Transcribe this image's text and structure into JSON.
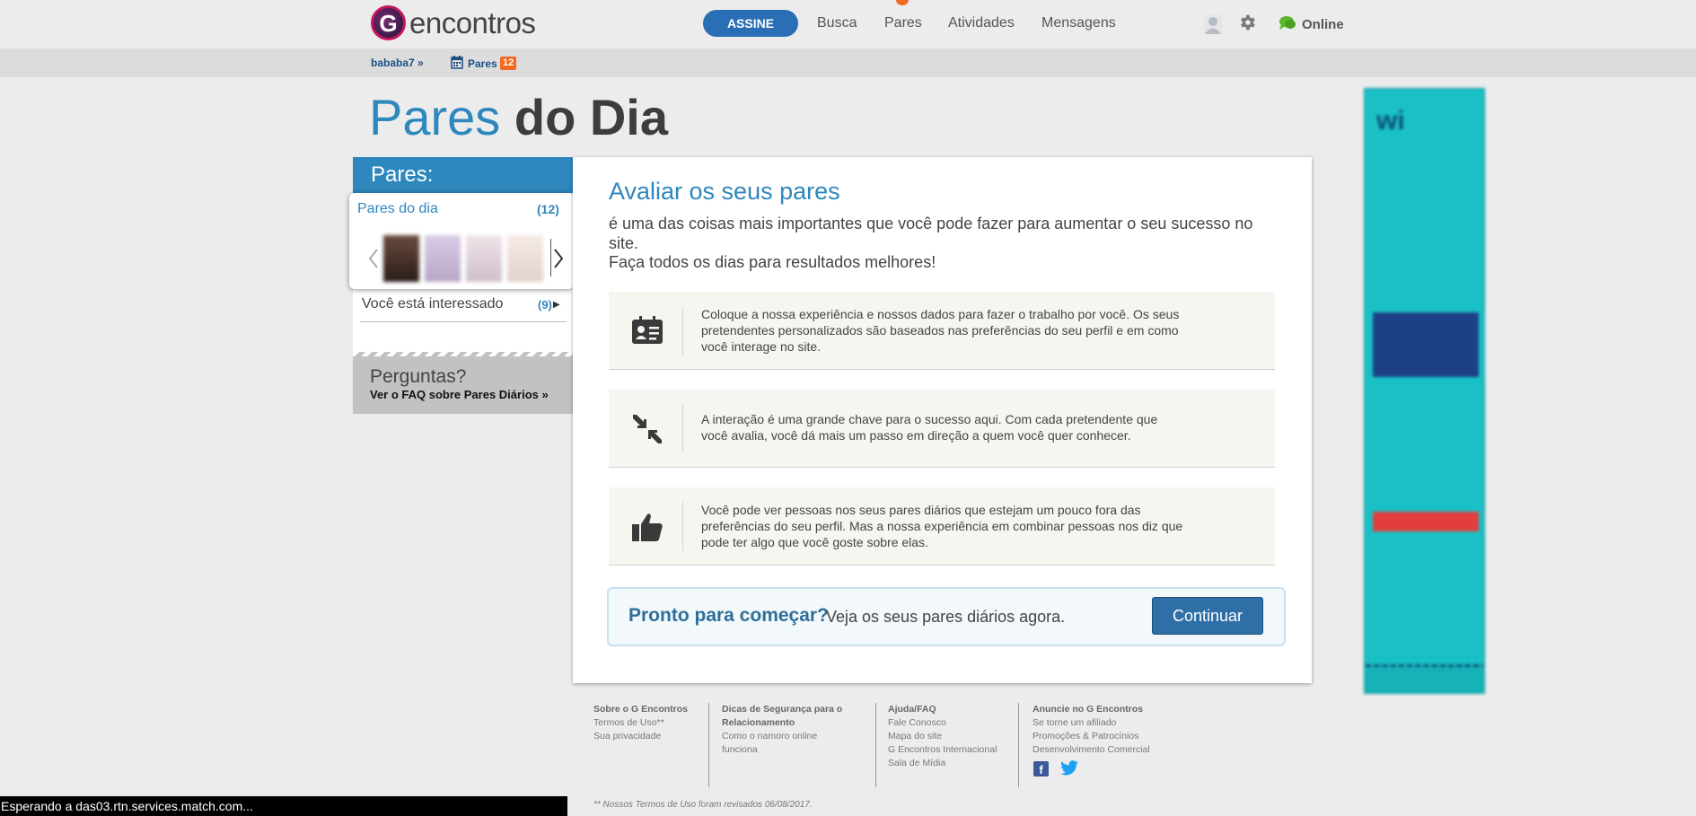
{
  "header": {
    "logo_letter": "G",
    "logo_text": "encontros",
    "subscribe": "ASSINE",
    "nav": [
      "Busca",
      "Pares",
      "Atividades",
      "Mensagens"
    ],
    "online": "Online",
    "accent": "#2a6fb5",
    "notify_color": "#f26a21"
  },
  "subbar": {
    "username": "bababa7 »",
    "pares_label": "Pares",
    "pares_count": "12"
  },
  "page": {
    "title_part1": "Pares",
    "title_part2": "do Dia"
  },
  "sidebar": {
    "heading": "Pares:",
    "daily_label": "Pares do dia",
    "daily_count": "(12)",
    "interested_label": "Você está interessado",
    "interested_count": "(9)",
    "faq_question": "Perguntas?",
    "faq_link": "Ver o FAQ sobre Pares Diários »"
  },
  "main": {
    "title": "Avaliar os seus pares",
    "subtitle": "é uma das coisas mais importantes que você pode fazer para aumentar o seu sucesso no site.",
    "subtitle2": "Faça todos os dias para resultados melhores!",
    "features": [
      {
        "icon": "id-card-icon",
        "text": "Coloque a nossa experiência e nossos dados para fazer o trabalho por você. Os seus pretendentes personalizados são baseados nas preferências do seu perfil e em como você interage no site."
      },
      {
        "icon": "compress-arrows-icon",
        "text": "A interação é uma grande chave para o sucesso aqui. Com cada pretendente que você avalia, você dá mais um passo em direção a quem você quer conhecer."
      },
      {
        "icon": "thumbs-up-icon",
        "text": "Você pode ver pessoas nos seus pares diários que estejam um pouco fora das preferências do seu perfil. Mas a nossa experiência em combinar pessoas nos diz que pode ter algo que você goste sobre elas."
      }
    ],
    "cta_strong": "Pronto para começar?",
    "cta_rest": "Veja os seus pares diários agora.",
    "continue": "Continuar"
  },
  "footer": {
    "cols": [
      {
        "heading": "Sobre o G Encontros",
        "links": [
          "Termos de Uso**",
          "Sua privacidade"
        ]
      },
      {
        "heading": "Dicas de Segurança para o Relacionamento",
        "links": [
          "Como o namoro online funciona"
        ]
      },
      {
        "heading": "Ajuda/FAQ",
        "links": [
          "Fale Conosco",
          "Mapa do site",
          "G Encontros Internacional",
          "Sala de Mídia"
        ]
      },
      {
        "heading": "Anuncie no G Encontros",
        "links": [
          "Se torne um afiliado",
          "Promoções & Patrocínios",
          "Desenvolvimento Comercial"
        ]
      }
    ],
    "note": "** Nossos Termos de Uso foram revisados 06/08/2017."
  },
  "status_bar": "Esperando a das03.rtn.services.match.com..."
}
